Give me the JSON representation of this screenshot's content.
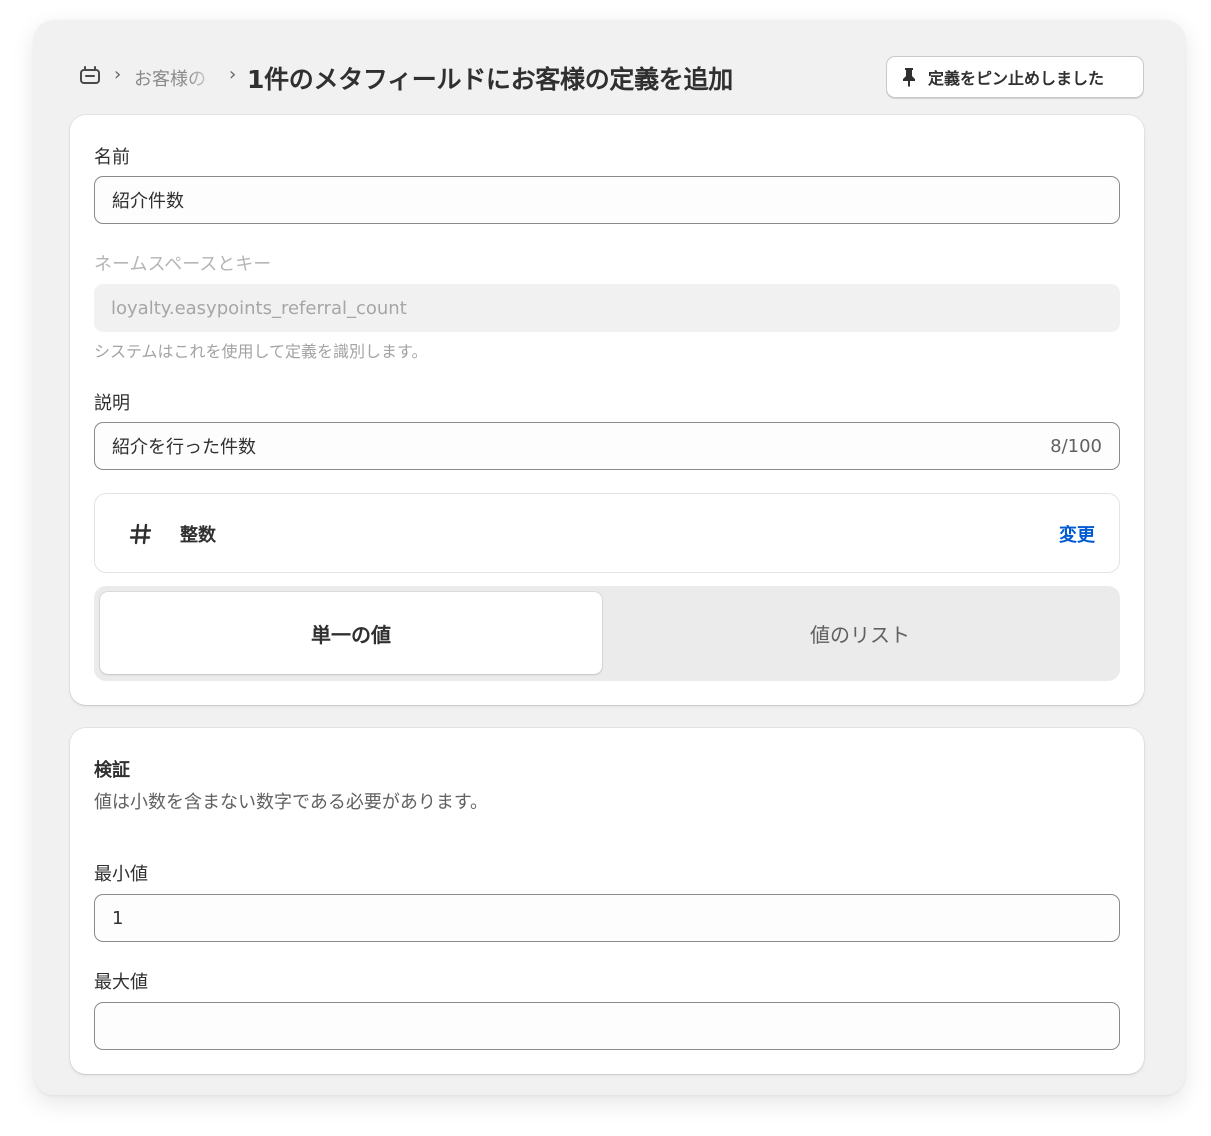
{
  "header": {
    "breadcrumb_parent": "お客様の",
    "title": "1件のメタフィールドにお客様の定義を追加",
    "pin_button_label": "定義をピン止めしました"
  },
  "form": {
    "name": {
      "label": "名前",
      "value": "紹介件数"
    },
    "namespace": {
      "label": "ネームスペースとキー",
      "value": "loyalty.easypoints_referral_count",
      "help": "システムはこれを使用して定義を識別します。"
    },
    "description": {
      "label": "説明",
      "value": "紹介を行った件数",
      "counter": "8/100"
    },
    "type": {
      "icon": "hash-icon",
      "name": "整数",
      "change_label": "変更"
    },
    "value_mode": {
      "options": [
        "単一の値",
        "値のリスト"
      ],
      "selected": "単一の値"
    }
  },
  "validation": {
    "title": "検証",
    "description": "値は小数を含まない数字である必要があります。",
    "min": {
      "label": "最小値",
      "value": "1"
    },
    "max": {
      "label": "最大値",
      "value": ""
    }
  },
  "colors": {
    "link": "#005bd3",
    "text": "#303030",
    "background": "#f1f1f1"
  }
}
